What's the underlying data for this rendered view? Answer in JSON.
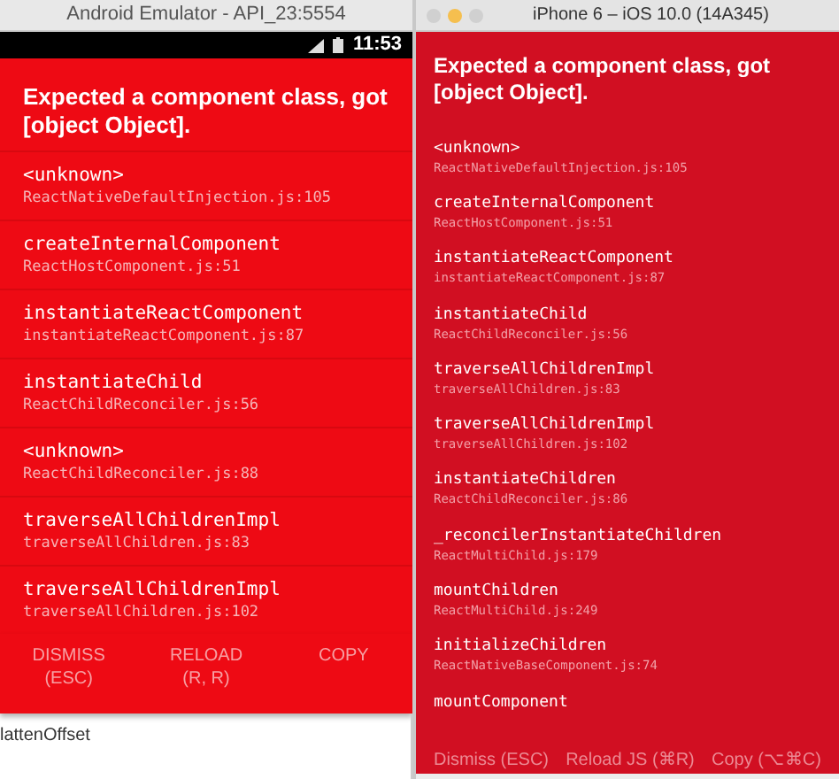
{
  "android": {
    "window_title": "Android Emulator - API_23:5554",
    "status_time": "11:53",
    "error_title": "Expected a component class, got [object Object].",
    "frames": [
      {
        "method": "<unknown>",
        "file": "ReactNativeDefaultInjection.js:105"
      },
      {
        "method": "createInternalComponent",
        "file": "ReactHostComponent.js:51"
      },
      {
        "method": "instantiateReactComponent",
        "file": "instantiateReactComponent.js:87"
      },
      {
        "method": "instantiateChild",
        "file": "ReactChildReconciler.js:56"
      },
      {
        "method": "<unknown>",
        "file": "ReactChildReconciler.js:88"
      },
      {
        "method": "traverseAllChildrenImpl",
        "file": "traverseAllChildren.js:83"
      },
      {
        "method": "traverseAllChildrenImpl",
        "file": "traverseAllChildren.js:102"
      }
    ],
    "buttons": [
      {
        "line1": "DISMISS",
        "line2": "(ESC)"
      },
      {
        "line1": "RELOAD",
        "line2": "(R, R)"
      },
      {
        "line1": "COPY"
      }
    ]
  },
  "background_lines": [
    "lattenOffset"
  ],
  "ios": {
    "window_title": "iPhone 6 – iOS 10.0 (14A345)",
    "error_title": "Expected a component class, got [object Object].",
    "frames": [
      {
        "method": "<unknown>",
        "file": "ReactNativeDefaultInjection.js:105"
      },
      {
        "method": "createInternalComponent",
        "file": "ReactHostComponent.js:51"
      },
      {
        "method": "instantiateReactComponent",
        "file": "instantiateReactComponent.js:87"
      },
      {
        "method": "instantiateChild",
        "file": "ReactChildReconciler.js:56"
      },
      {
        "method": "traverseAllChildrenImpl",
        "file": "traverseAllChildren.js:83"
      },
      {
        "method": "traverseAllChildrenImpl",
        "file": "traverseAllChildren.js:102"
      },
      {
        "method": "instantiateChildren",
        "file": "ReactChildReconciler.js:86"
      },
      {
        "method": "_reconcilerInstantiateChildren",
        "file": "ReactMultiChild.js:179"
      },
      {
        "method": "mountChildren",
        "file": "ReactMultiChild.js:249"
      },
      {
        "method": "initializeChildren",
        "file": "ReactNativeBaseComponent.js:74"
      },
      {
        "method": "mountComponent"
      }
    ],
    "buttons": [
      "Dismiss (ESC)",
      "Reload JS (⌘R)",
      "Copy (⌥⌘C)"
    ]
  }
}
